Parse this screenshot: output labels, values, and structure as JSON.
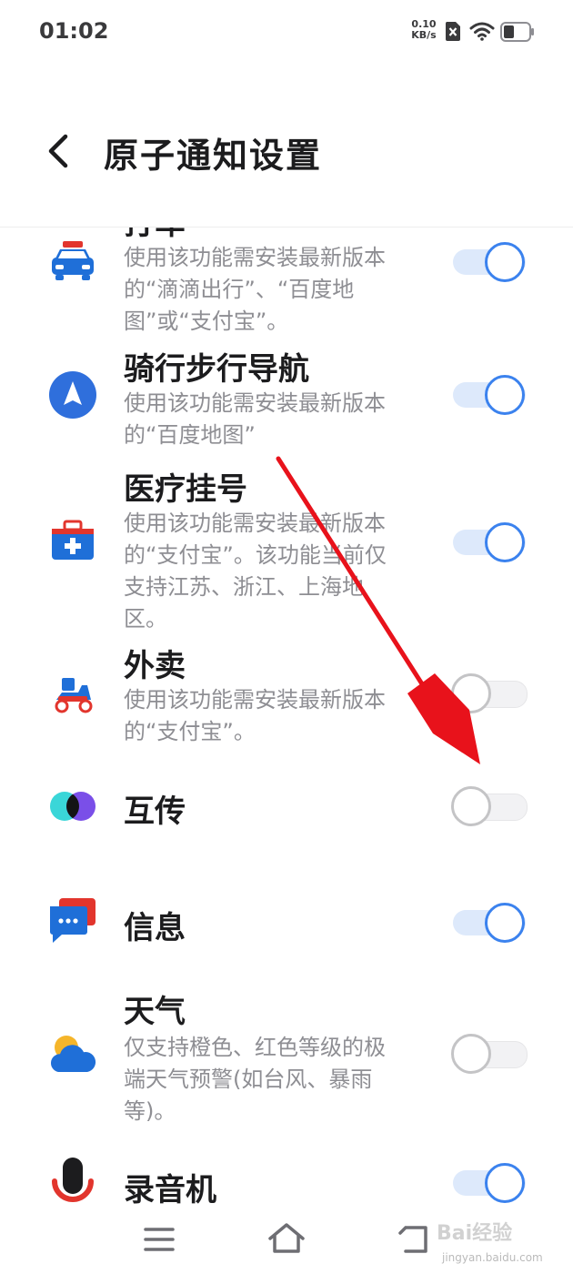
{
  "status_bar": {
    "time": "01:02",
    "net_speed_value": "0.10",
    "net_speed_unit": "KB/s",
    "icons": [
      "sim-x-icon",
      "wifi-icon",
      "battery-icon"
    ]
  },
  "header": {
    "title": "原子通知设置",
    "back_icon": "chevron-left-icon"
  },
  "items": [
    {
      "title": "打车",
      "desc": "使用该功能需安装最新版本的“滴滴出行”、“百度地图”或“支付宝”。",
      "enabled": true,
      "icon": "taxi-icon"
    },
    {
      "title": "骑行步行导航",
      "desc": "使用该功能需安装最新版本的“百度地图”",
      "enabled": true,
      "icon": "navigation-icon"
    },
    {
      "title": "医疗挂号",
      "desc": "使用该功能需安装最新版本的“支付宝”。该功能当前仅支持江苏、浙江、上海地区。",
      "enabled": true,
      "icon": "medical-kit-icon"
    },
    {
      "title": "外卖",
      "desc": "使用该功能需安装最新版本的“支付宝”。",
      "enabled": false,
      "icon": "delivery-scooter-icon"
    },
    {
      "title": "互传",
      "desc": "",
      "enabled": false,
      "icon": "share-transfer-icon"
    },
    {
      "title": "信息",
      "desc": "",
      "enabled": true,
      "icon": "message-icon"
    },
    {
      "title": "天气",
      "desc": "仅支持橙色、红色等级的极端天气预警(如台风、暴雨等)。",
      "enabled": false,
      "icon": "weather-icon"
    },
    {
      "title": "录音机",
      "desc": "",
      "enabled": true,
      "icon": "microphone-icon"
    }
  ],
  "nav_bar": {
    "icons": [
      "menu-icon",
      "home-icon",
      "back-icon"
    ]
  },
  "watermark": {
    "text": "Bai经验",
    "url": "jingyan.baidu.com"
  },
  "colors": {
    "accent": "#3b82ee",
    "toggle_on_track": "#dde9fb",
    "annotation_arrow": "#e8121b"
  }
}
